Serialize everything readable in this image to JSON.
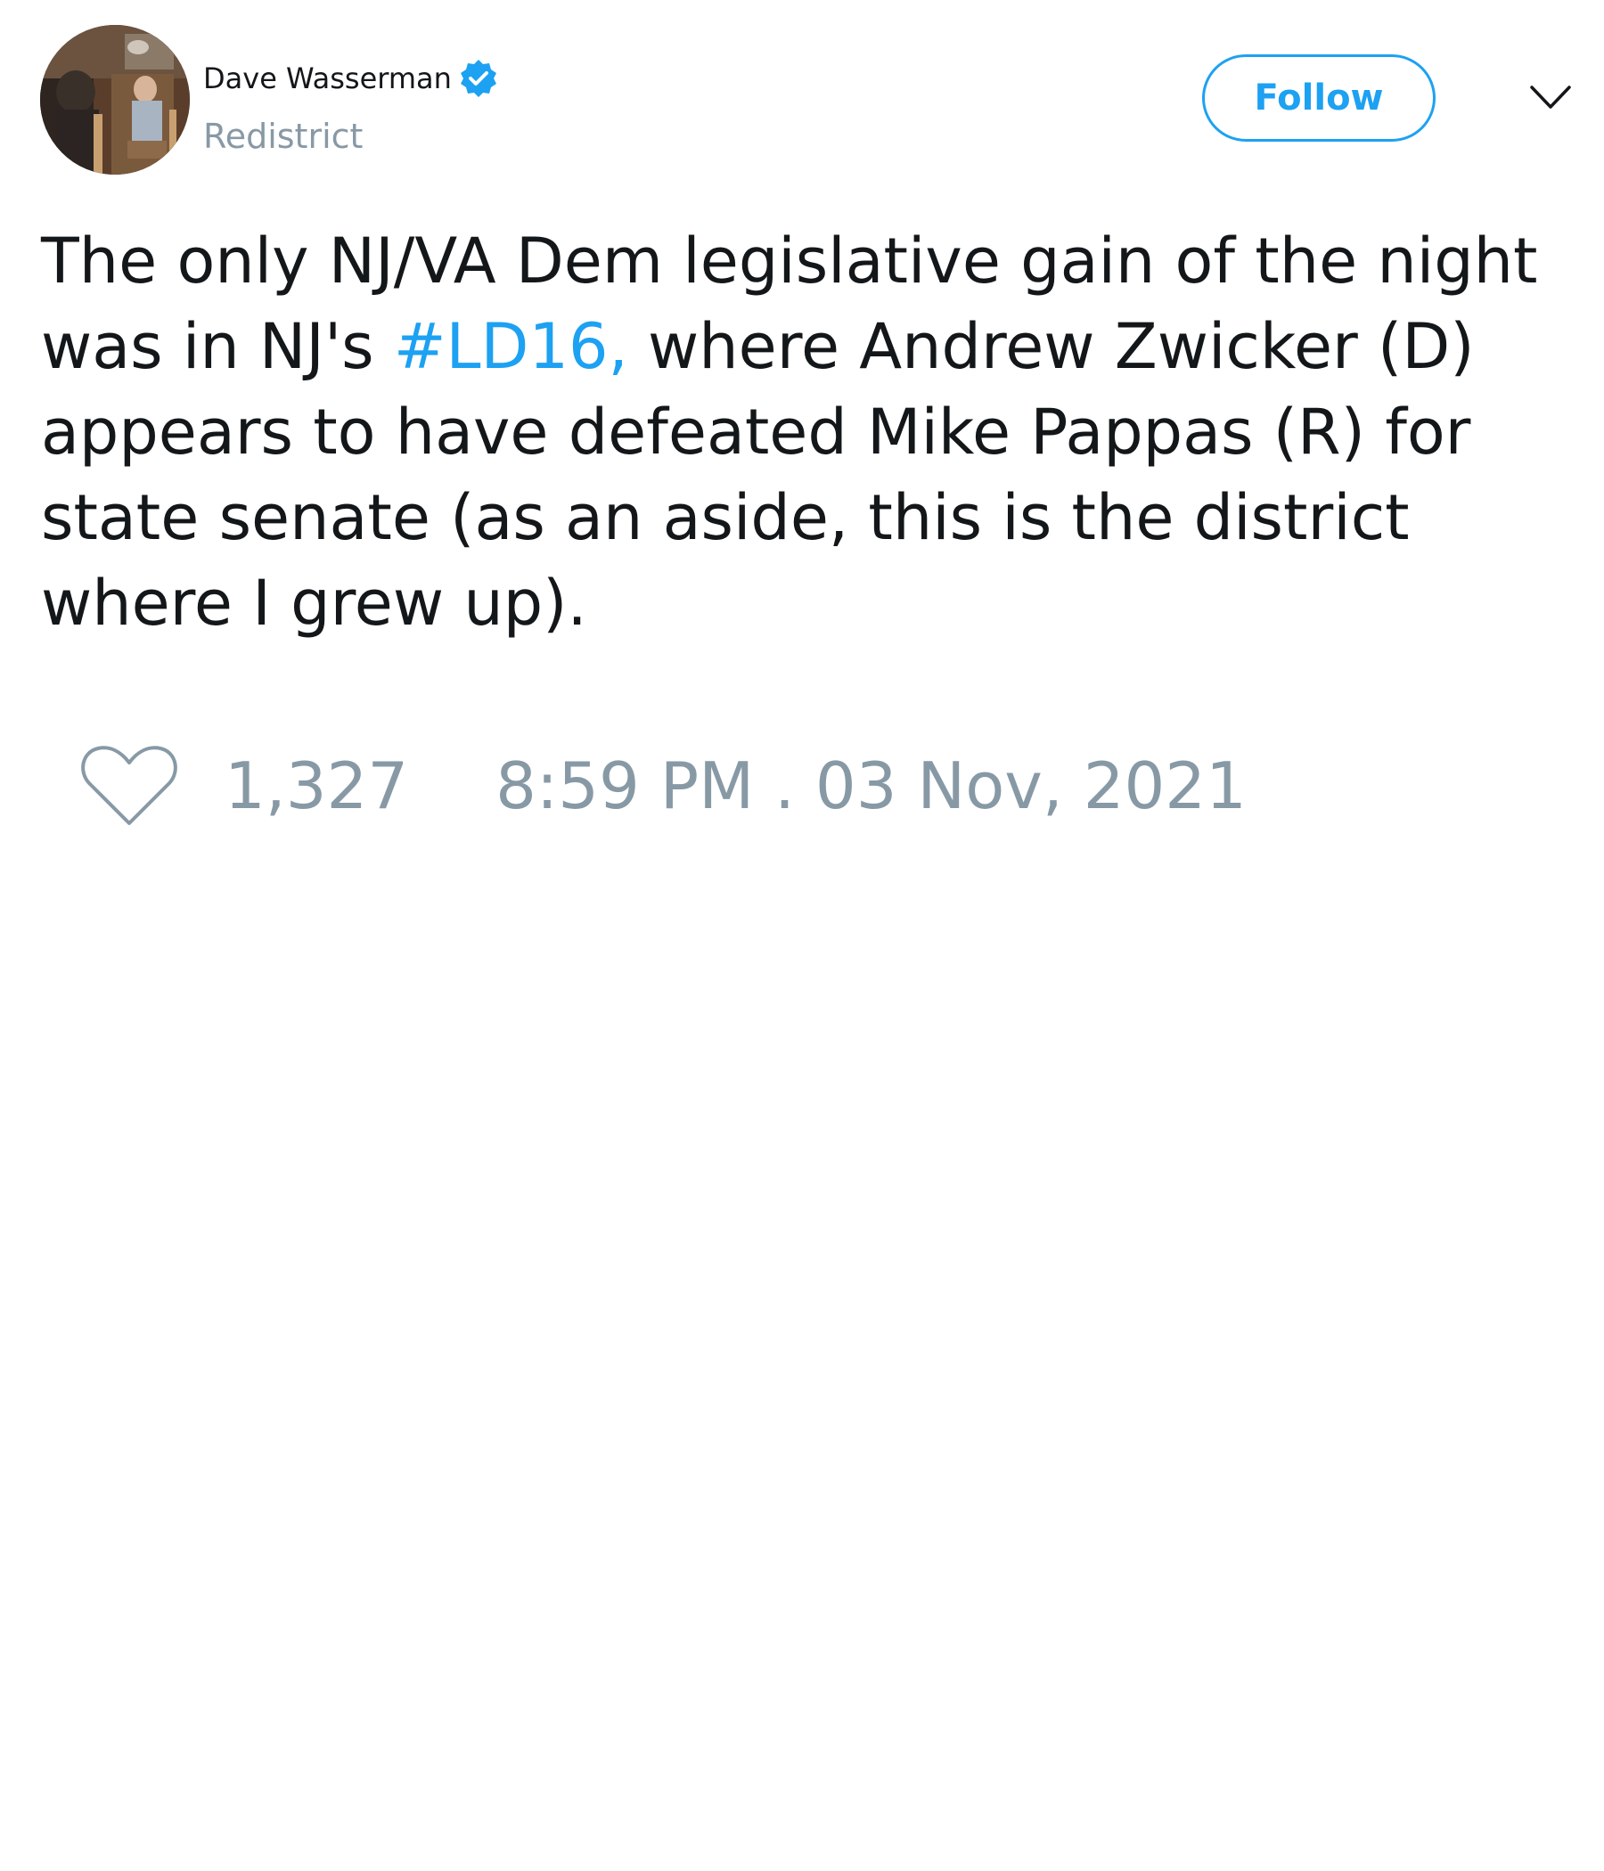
{
  "author": {
    "display_name": "Dave Wasserman",
    "handle": "Redistrict",
    "verified": true
  },
  "header": {
    "follow_label": "Follow"
  },
  "tweet": {
    "text_before_hashtag": "The only NJ/VA Dem legislative gain of the night\nwas in NJ's ",
    "hashtag": "#LD16,",
    "text_after_hashtag": " where Andrew Zwicker (D)\nappears to have defeated Mike Pappas (R) for\nstate senate (as an aside, this is the district\nwhere I grew up)."
  },
  "footer": {
    "like_count": "1,327",
    "timestamp": "8:59 PM . 03 Nov, 2021"
  },
  "icons": {
    "avatar": "avatar-photo",
    "verified": "verified-badge-icon",
    "menu": "chevron-down-icon",
    "like": "heart-icon"
  },
  "colors": {
    "accent": "#1da1f2",
    "text": "#14171a",
    "muted": "#8899a6",
    "background": "#ffffff"
  }
}
